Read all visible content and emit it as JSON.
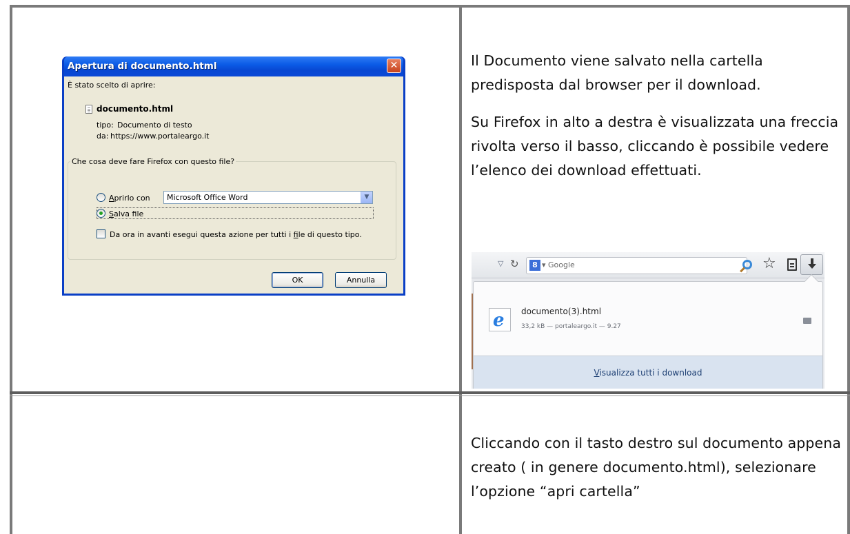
{
  "row1": {
    "paragraphs": [
      "Il Documento viene salvato nella cartella predisposta dal browser per il download.",
      "Su Firefox in alto a destra è visualizzata una freccia rivolta verso il basso, cliccando è possibile vedere l’elenco dei download effettuati."
    ]
  },
  "row2": {
    "paragraphs": [
      "Cliccando con il tasto destro sul documento appena creato ( in genere documento.html), selezionare l’opzione “apri cartella”"
    ]
  },
  "dialog": {
    "title": "Apertura di documento.html",
    "close_icon": "close-x",
    "intro": "È stato scelto di aprire:",
    "file_name": "documento.html",
    "type_label": "tipo:",
    "type_value": "Documento di testo",
    "from_label": "da:",
    "from_value": "https://www.portaleargo.it",
    "group_label": "Che cosa deve fare Firefox con questo file?",
    "open_with_label_a": "A",
    "open_with_label_rest": "prirlo con",
    "open_with_app": "Microsoft Office Word",
    "save_label_a": "S",
    "save_label_rest": "alva file",
    "always_pre": "Da ora in avanti esegui questa azione per tutti i ",
    "always_ak": "f",
    "always_post": "ile di questo tipo.",
    "ok_label": "OK",
    "cancel_label": "Annulla",
    "selected_option": "save"
  },
  "firefox": {
    "search_engine_label": "Google",
    "download_file_name": "documento(3).html",
    "download_meta": "33,2 kB — portaleargo.it — 9.27",
    "show_all_ak": "V",
    "show_all_rest": "isualizza tutti i download"
  }
}
